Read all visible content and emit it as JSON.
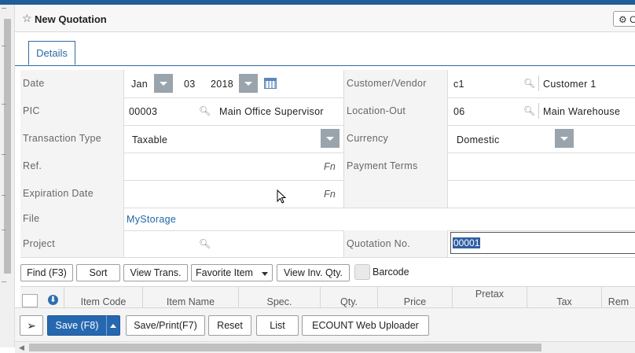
{
  "header": {
    "title": "New Quotation",
    "options_label": "O"
  },
  "tabs": [
    {
      "label": "Details"
    }
  ],
  "form": {
    "date": {
      "label": "Date",
      "month": "Jan",
      "day": "03",
      "year": "2018"
    },
    "customer": {
      "label": "Customer/Vendor",
      "code": "c1",
      "name": "Customer 1"
    },
    "pic": {
      "label": "PIC",
      "code": "00003",
      "name": "Main Office Supervisor"
    },
    "location_out": {
      "label": "Location-Out",
      "code": "06",
      "name": "Main Warehouse"
    },
    "transaction_type": {
      "label": "Transaction Type",
      "value": "Taxable"
    },
    "currency": {
      "label": "Currency",
      "value": "Domestic"
    },
    "ref": {
      "label": "Ref.",
      "fn": "Fn"
    },
    "payment_terms": {
      "label": "Payment Terms"
    },
    "expiration_date": {
      "label": "Expiration Date",
      "fn": "Fn"
    },
    "file": {
      "label": "File",
      "value": "MyStorage"
    },
    "project": {
      "label": "Project"
    },
    "quotation_no": {
      "label": "Quotation No.",
      "value": "00001"
    }
  },
  "toolbar": {
    "find": "Find (F3)",
    "sort": "Sort",
    "view_trans": "View Trans.",
    "favorite_item": "Favorite Item",
    "view_inv_qty": "View Inv. Qty.",
    "barcode": "Barcode"
  },
  "grid": {
    "columns": [
      "Item Code",
      "Item Name",
      "Spec.",
      "Qty.",
      "Price",
      "Pretax",
      "Tax",
      "Rem"
    ]
  },
  "bottom": {
    "save": "Save (F8)",
    "save_print": "Save/Print(F7)",
    "reset": "Reset",
    "list": "List",
    "uploader": "ECOUNT Web Uploader"
  },
  "colors": {
    "accent": "#2668b0",
    "topbar": "#1f5f96",
    "label_bg": "#f4f4f4"
  }
}
